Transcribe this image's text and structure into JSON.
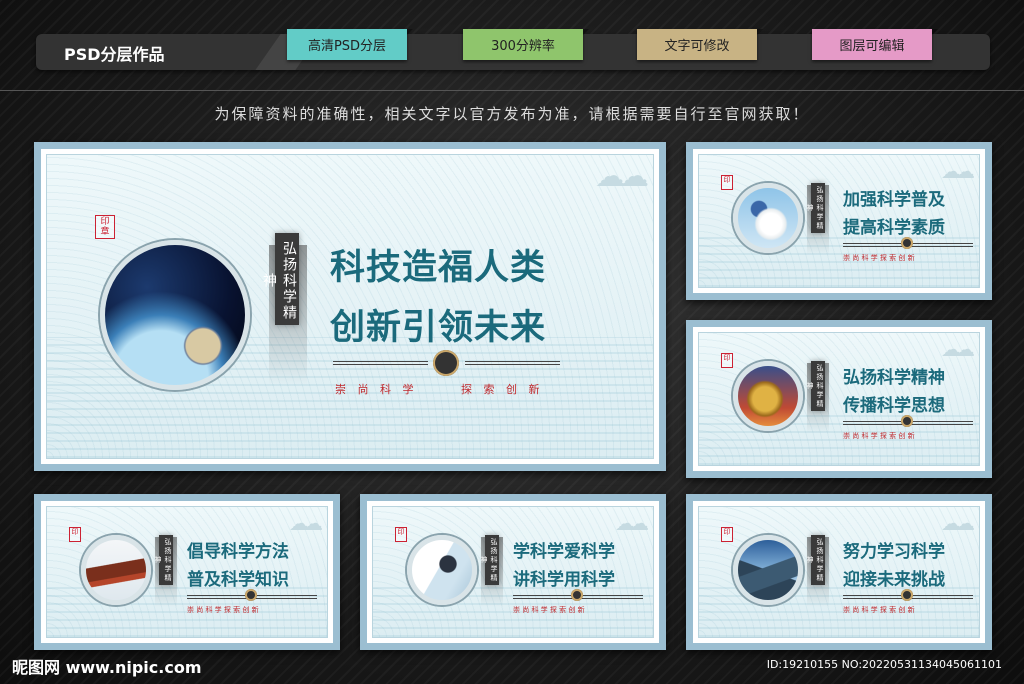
{
  "header": {
    "title": "PSD分层作品",
    "tags": [
      "高清PSD分层",
      "300分辨率",
      "文字可修改",
      "图层可编辑"
    ]
  },
  "notice": "为保障资料的准确性，相关文字以官方发布为准，请根据需要自行至官网获取！",
  "main_board": {
    "vertical_text": "弘扬科学精神",
    "line1": "科技造福人类",
    "line2": "创新引领未来",
    "motto_left": "崇 尚 科 学",
    "motto_right": "探 索 创 新"
  },
  "boards": [
    {
      "line1": "加强科学普及",
      "line2": "提高科学素质",
      "motto": "崇 尚 科 学   探 索 创 新",
      "image": "butterfly-dandelion"
    },
    {
      "line1": "弘扬科学精神",
      "line2": "传播科学思想",
      "motto": "崇 尚 科 学   探 索 创 新",
      "image": "golden-dragon"
    },
    {
      "line1": "倡导科学方法",
      "line2": "普及科学知识",
      "motto": "崇 尚 科 学   探 索 创 新",
      "image": "pagoda-roof"
    },
    {
      "line1": "学科学爱科学",
      "line2": "讲科学用科学",
      "motto": "崇 尚 科 学   探 索 创 新",
      "image": "microscope"
    },
    {
      "line1": "努力学习科学",
      "line2": "迎接未来挑战",
      "motto": "崇 尚 科 学   探 索 创 新",
      "image": "mountains"
    }
  ],
  "footer": {
    "logo": "昵图网 www.nipic.com",
    "id": "ID:19210155 NO:20220531134045061101"
  },
  "colors": {
    "board_frame": "#9bbed1",
    "headline": "#1b6a7c",
    "motto": "#c0282c"
  }
}
